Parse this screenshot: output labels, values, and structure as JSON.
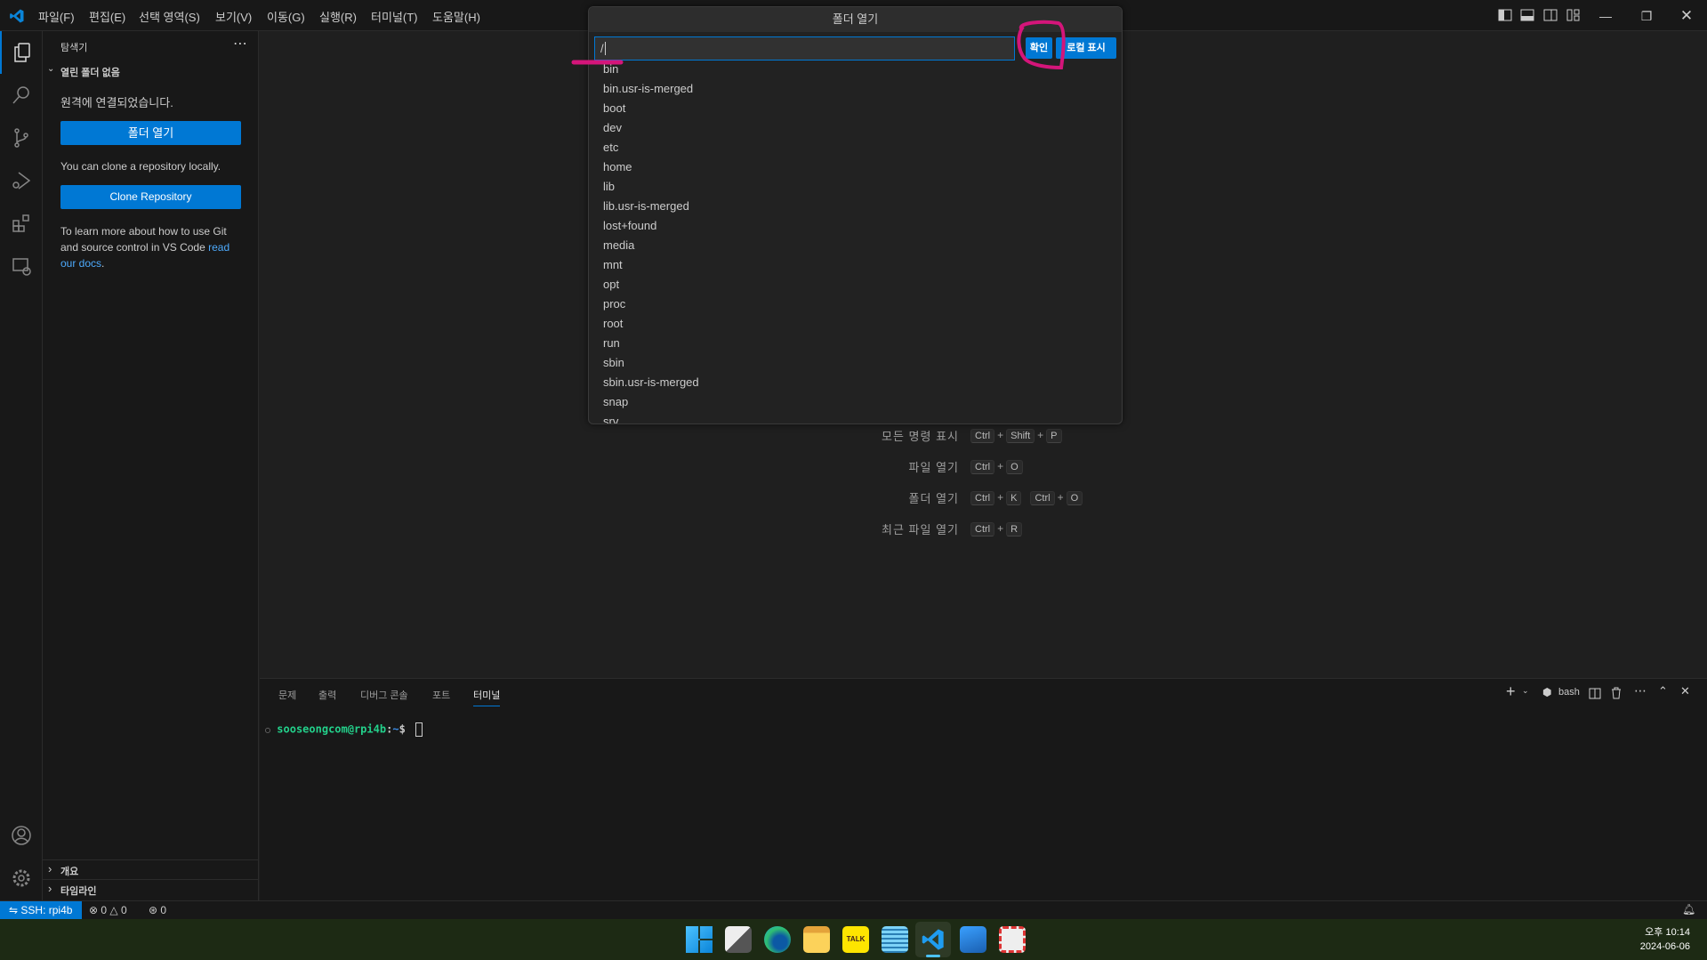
{
  "titlebar": {
    "menu": [
      "파일(F)",
      "편집(E)",
      "선택 영역(S)",
      "보기(V)",
      "이동(G)",
      "실행(R)",
      "터미널(T)",
      "도움말(H)"
    ]
  },
  "sidebar": {
    "title": "탐색기",
    "section": "열린 폴더 없음",
    "connected": "원격에 연결되었습니다.",
    "open_folder": "폴더 열기",
    "clone_text": "You can clone a repository locally.",
    "clone_button": "Clone Repository",
    "learn_text": "To learn more about how to use Git and source control in VS Code ",
    "learn_link": "read our docs",
    "learn_end": ".",
    "outline": "개요",
    "timeline": "타임라인"
  },
  "quick_open": {
    "title": "폴더 열기",
    "value": "/",
    "ok": "확인",
    "show_local": "로컬 표시",
    "items": [
      "bin",
      "bin.usr-is-merged",
      "boot",
      "dev",
      "etc",
      "home",
      "lib",
      "lib.usr-is-merged",
      "lost+found",
      "media",
      "mnt",
      "opt",
      "proc",
      "root",
      "run",
      "sbin",
      "sbin.usr-is-merged",
      "snap",
      "srv"
    ]
  },
  "shortcuts": [
    {
      "label": "모든 명령 표시",
      "keys": [
        [
          "Ctrl",
          "Shift",
          "P"
        ]
      ]
    },
    {
      "label": "파일 열기",
      "keys": [
        [
          "Ctrl",
          "O"
        ]
      ]
    },
    {
      "label": "폴더 열기",
      "keys": [
        [
          "Ctrl",
          "K"
        ],
        [
          "Ctrl",
          "O"
        ]
      ]
    },
    {
      "label": "최근 파일 열기",
      "keys": [
        [
          "Ctrl",
          "R"
        ]
      ]
    }
  ],
  "panel": {
    "tabs": [
      "문제",
      "출력",
      "디버그 콘솔",
      "포트",
      "터미널"
    ],
    "active_tab": "터미널",
    "shell": "bash",
    "prompt_user": "sooseongcom@rpi4b",
    "prompt_sep": ":",
    "prompt_path": "~",
    "prompt_char": "$"
  },
  "statusbar": {
    "remote": "SSH: rpi4b",
    "errors": "0",
    "warnings": "0",
    "ports": "0"
  },
  "taskbar": {
    "time": "오후 10:14",
    "date": "2024-06-06",
    "apps": [
      "windows-start",
      "task-view",
      "edge",
      "file-explorer",
      "kakaotalk",
      "notepad",
      "vscode",
      "photos",
      "snipping-tool"
    ]
  },
  "colors": {
    "accent": "#0078d4",
    "annotation": "#d4157a",
    "prompt_green": "#23d18b",
    "prompt_blue": "#3b8eea"
  }
}
